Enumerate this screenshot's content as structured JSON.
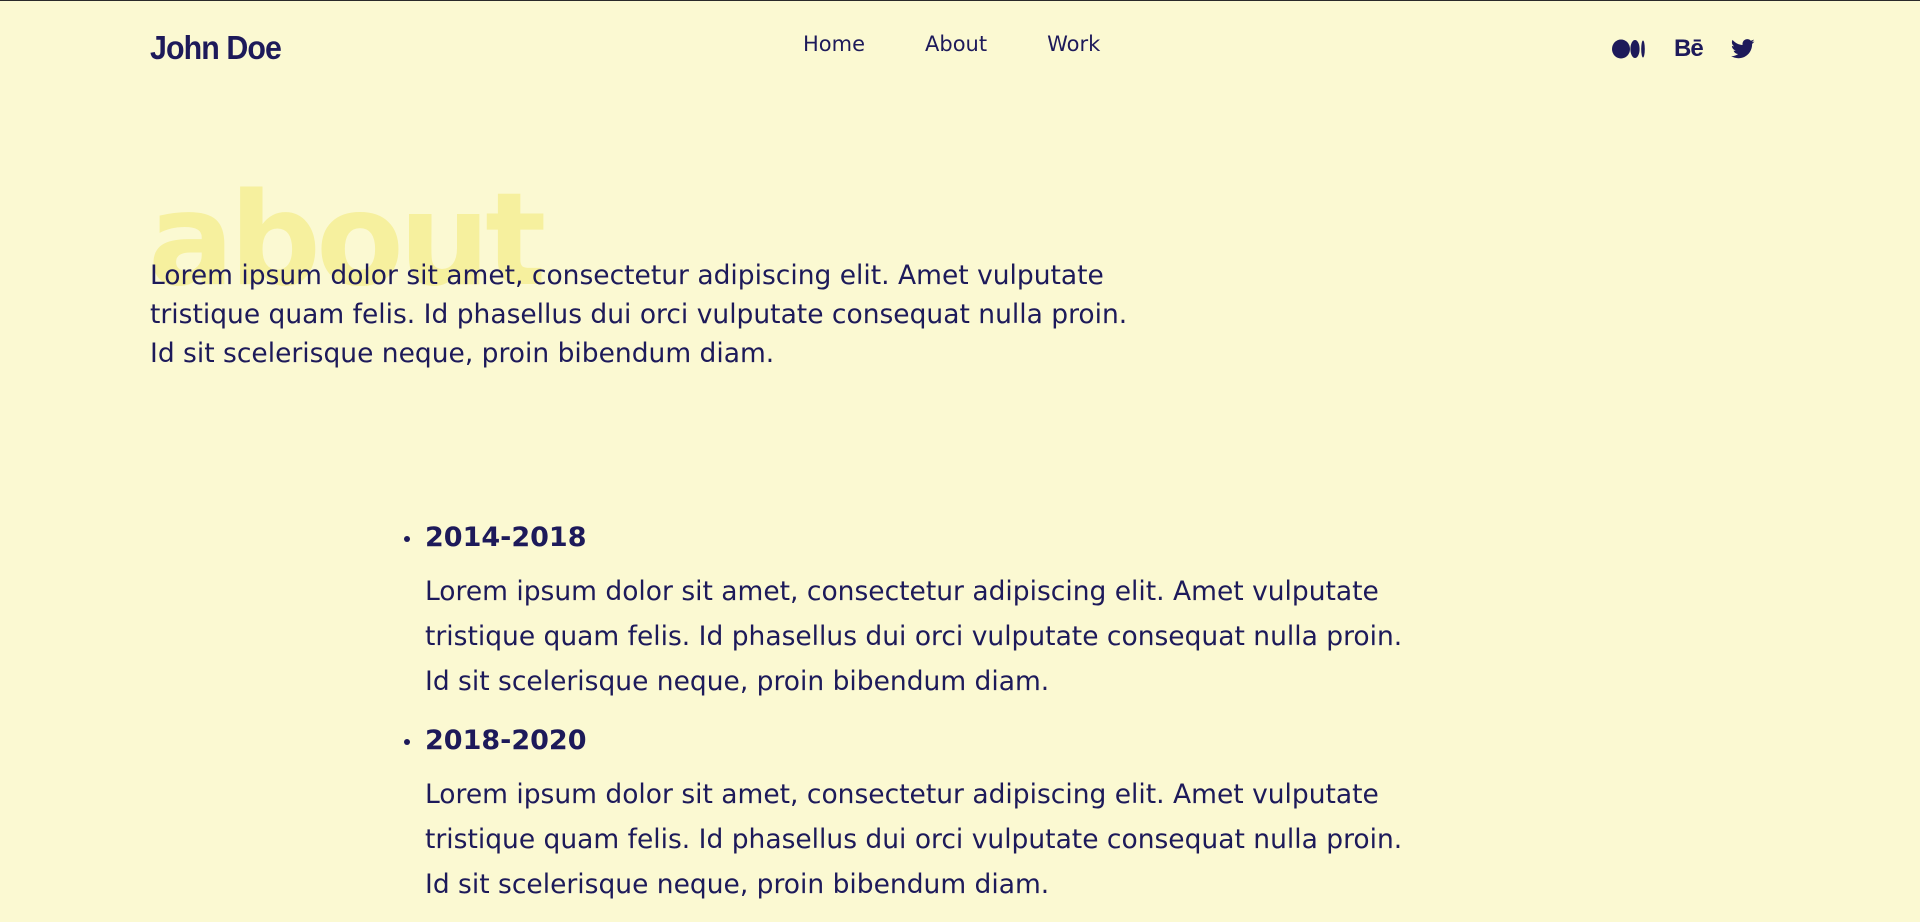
{
  "header": {
    "logo": "John Doe",
    "nav": [
      {
        "label": "Home"
      },
      {
        "label": "About"
      },
      {
        "label": "Work"
      }
    ],
    "social": {
      "behance_label": "Bē"
    }
  },
  "hero": {
    "title": "about",
    "intro": "Lorem ipsum dolor sit amet, consectetur adipiscing elit. Amet vulputate tristique quam felis. Id phasellus dui orci vulputate consequat nulla proin. Id sit scelerisque neque, proin bibendum diam."
  },
  "timeline": [
    {
      "year": "2014-2018",
      "text": "Lorem ipsum dolor sit amet, consectetur adipiscing elit. Amet vulputate tristique quam felis. Id phasellus dui orci vulputate consequat nulla proin. Id sit scelerisque neque, proin bibendum diam."
    },
    {
      "year": "2018-2020",
      "text": "Lorem ipsum dolor sit amet, consectetur adipiscing elit. Amet vulputate tristique quam felis. Id phasellus dui orci vulputate consequat nulla proin. Id sit scelerisque neque, proin bibendum diam."
    }
  ],
  "colors": {
    "background": "#fbf9d2",
    "text": "#1d1a5a",
    "hero_title": "#f6f09e"
  },
  "icons": [
    "medium-icon",
    "behance-icon",
    "twitter-icon"
  ]
}
